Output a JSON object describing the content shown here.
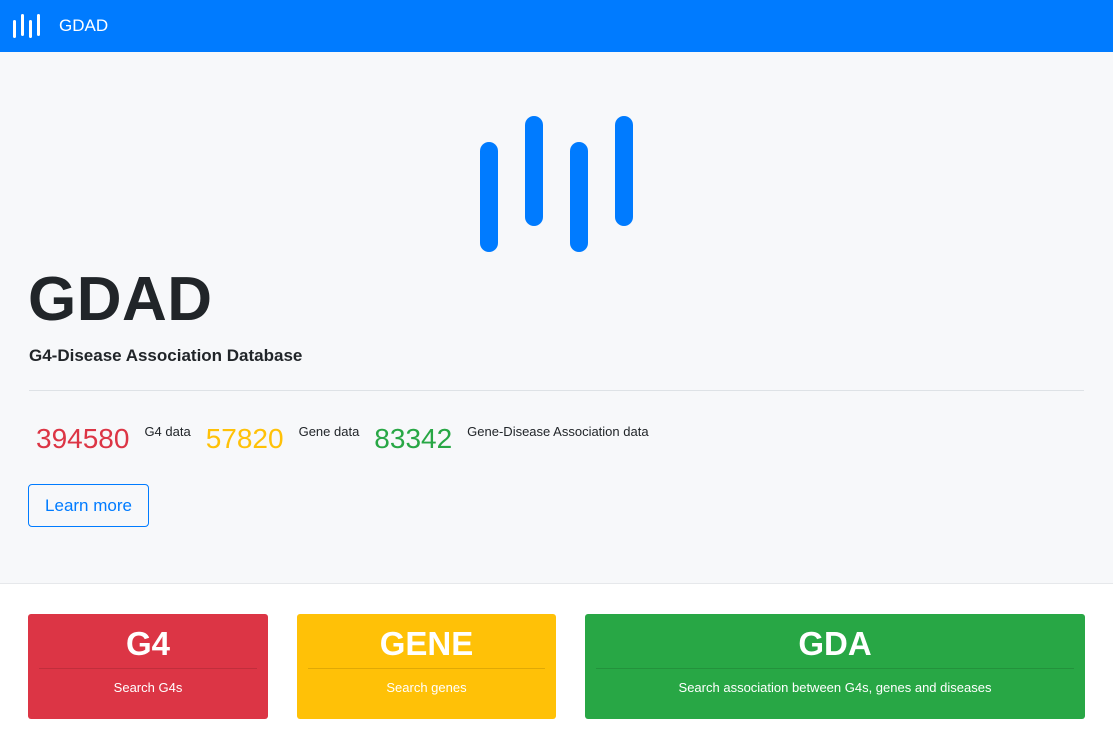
{
  "navbar": {
    "brand": "GDAD",
    "logo_icon": "bars-logo-icon",
    "color": "#007bff"
  },
  "hero": {
    "logo_icon": "bars-logo-icon",
    "title": "GDAD",
    "subtitle": "G4-Disease Association Database",
    "stats": [
      {
        "value": "394580",
        "label": "G4 data",
        "color": "#dc3545"
      },
      {
        "value": "57820",
        "label": "Gene data",
        "color": "#ffc107"
      },
      {
        "value": "83342",
        "label": "Gene-Disease Association data",
        "color": "#28a745"
      }
    ],
    "learn_more": "Learn more"
  },
  "cards": [
    {
      "title": "G4",
      "description": "Search G4s",
      "color": "#dc3545"
    },
    {
      "title": "GENE",
      "description": "Search genes",
      "color": "#ffc107"
    },
    {
      "title": "GDA",
      "description": "Search association between G4s, genes and diseases",
      "color": "#28a745"
    }
  ]
}
